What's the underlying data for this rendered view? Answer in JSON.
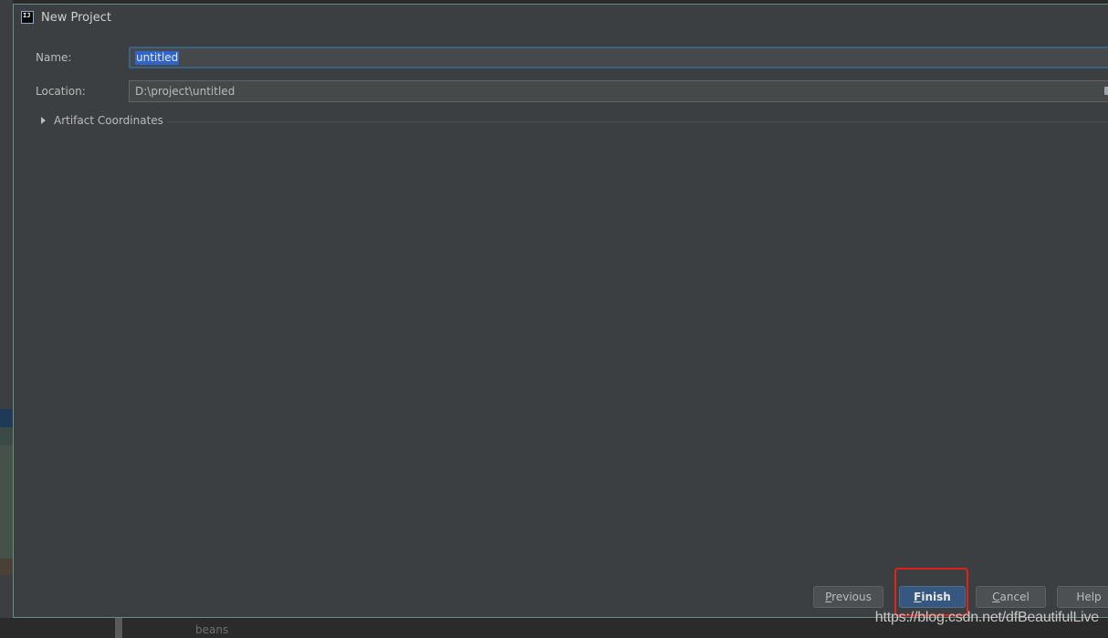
{
  "background": {
    "bottom_text": "beans",
    "watermark": "https://blog.csdn.net/dfBeautifulLive"
  },
  "dialog": {
    "title": "New Project",
    "app_icon": "intellij-icon",
    "app_icon_text": "IJ",
    "name": {
      "label": "Name:",
      "value": "untitled"
    },
    "location": {
      "label": "Location:",
      "value": "D:\\project\\untitled",
      "browse_icon": "folder-icon"
    },
    "artifact_section": {
      "label": "Artifact Coordinates",
      "expanded": false
    },
    "buttons": {
      "previous": "Previous",
      "finish": "Finish",
      "cancel": "Cancel",
      "help": "Help"
    }
  },
  "colors": {
    "dialog_bg": "#3c3f41",
    "primary_button": "#365880",
    "highlight_box": "#e0221d",
    "selection": "#2f65ca"
  }
}
